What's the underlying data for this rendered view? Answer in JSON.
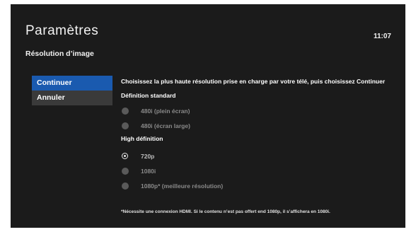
{
  "header": {
    "title": "Paramètres",
    "clock": "11:07"
  },
  "section": {
    "title": "Résolution d’image"
  },
  "menu": {
    "items": [
      {
        "label": "Continuer",
        "active": true
      },
      {
        "label": "Annuler",
        "active": false
      }
    ]
  },
  "content": {
    "instructions": "Choisissez la plus haute résolution prise en charge par votre télé, puis choisissez Continuer",
    "groups": [
      {
        "label": "Définition standard",
        "options": [
          {
            "label": "480i (plein écran)",
            "selected": false
          },
          {
            "label": "480i (écran large)",
            "selected": false
          }
        ]
      },
      {
        "label": "High définition",
        "options": [
          {
            "label": "720p",
            "selected": true
          },
          {
            "label": "1080i",
            "selected": false
          },
          {
            "label": "1080p* (meilleure résolution)",
            "selected": false
          }
        ]
      }
    ],
    "footnote": "*Nécessite une connexion HDMI. Si le contenu n’est pas offert end 1080p, il s’affichera en 1080i."
  },
  "colors": {
    "background": "#1b1b1b",
    "accent": "#1a5aaf",
    "menu_item": "#3a3a3a",
    "radio_inactive": "#5a5a5a"
  }
}
